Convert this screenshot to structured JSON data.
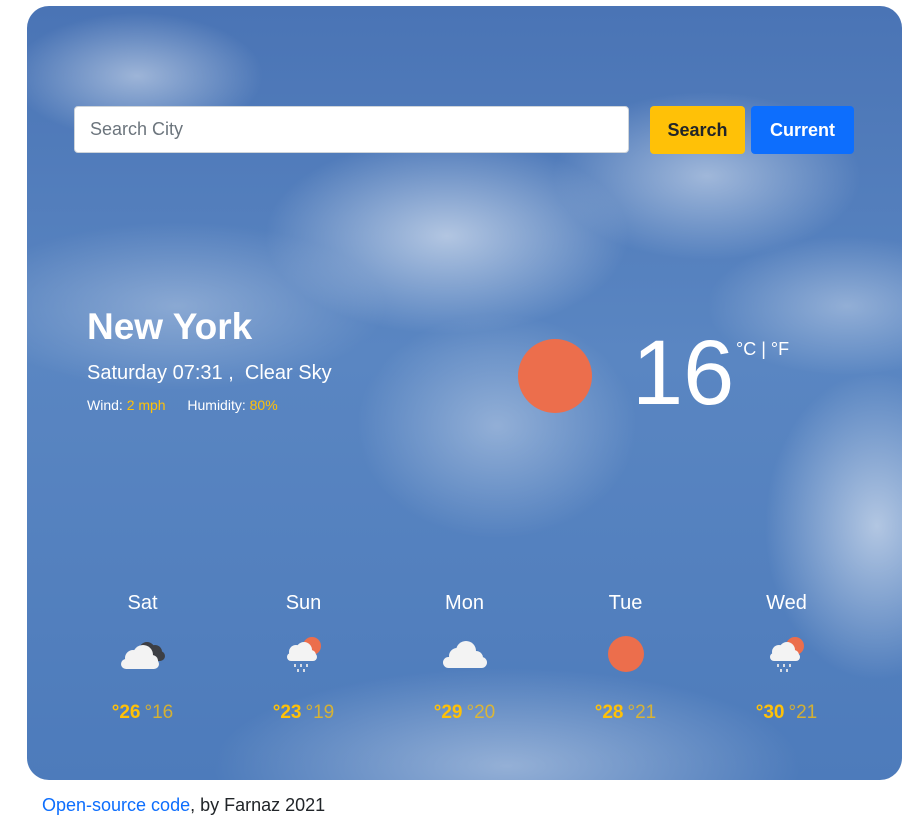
{
  "search": {
    "placeholder": "Search City",
    "value": ""
  },
  "buttons": {
    "search": "Search",
    "current": "Current"
  },
  "current": {
    "city": "New York",
    "day_time": "Saturday 07:31 ,",
    "description": "Clear Sky",
    "wind_label": "Wind:",
    "wind_value": "2 mph",
    "humidity_label": "Humidity:",
    "humidity_value": "80%",
    "temperature": "16",
    "unit_c": "°C",
    "unit_sep": "|",
    "unit_f": "°F",
    "icon": "sun-icon"
  },
  "forecast": [
    {
      "day": "Sat",
      "icon": "dark-cloud-icon",
      "max": "°26",
      "min": "°16"
    },
    {
      "day": "Sun",
      "icon": "sun-rain-cloud-icon",
      "max": "°23",
      "min": "°19"
    },
    {
      "day": "Mon",
      "icon": "cloud-icon",
      "max": "°29",
      "min": "°20"
    },
    {
      "day": "Tue",
      "icon": "sun-icon",
      "max": "°28",
      "min": "°21"
    },
    {
      "day": "Wed",
      "icon": "sun-rain-cloud-icon",
      "max": "°30",
      "min": "°21"
    }
  ],
  "footer": {
    "link_text": "Open-source code",
    "suffix": ", by Farnaz 2021"
  },
  "colors": {
    "accent": "#ffc107",
    "primary": "#0d6efd",
    "sun": "#ec6e4c"
  }
}
